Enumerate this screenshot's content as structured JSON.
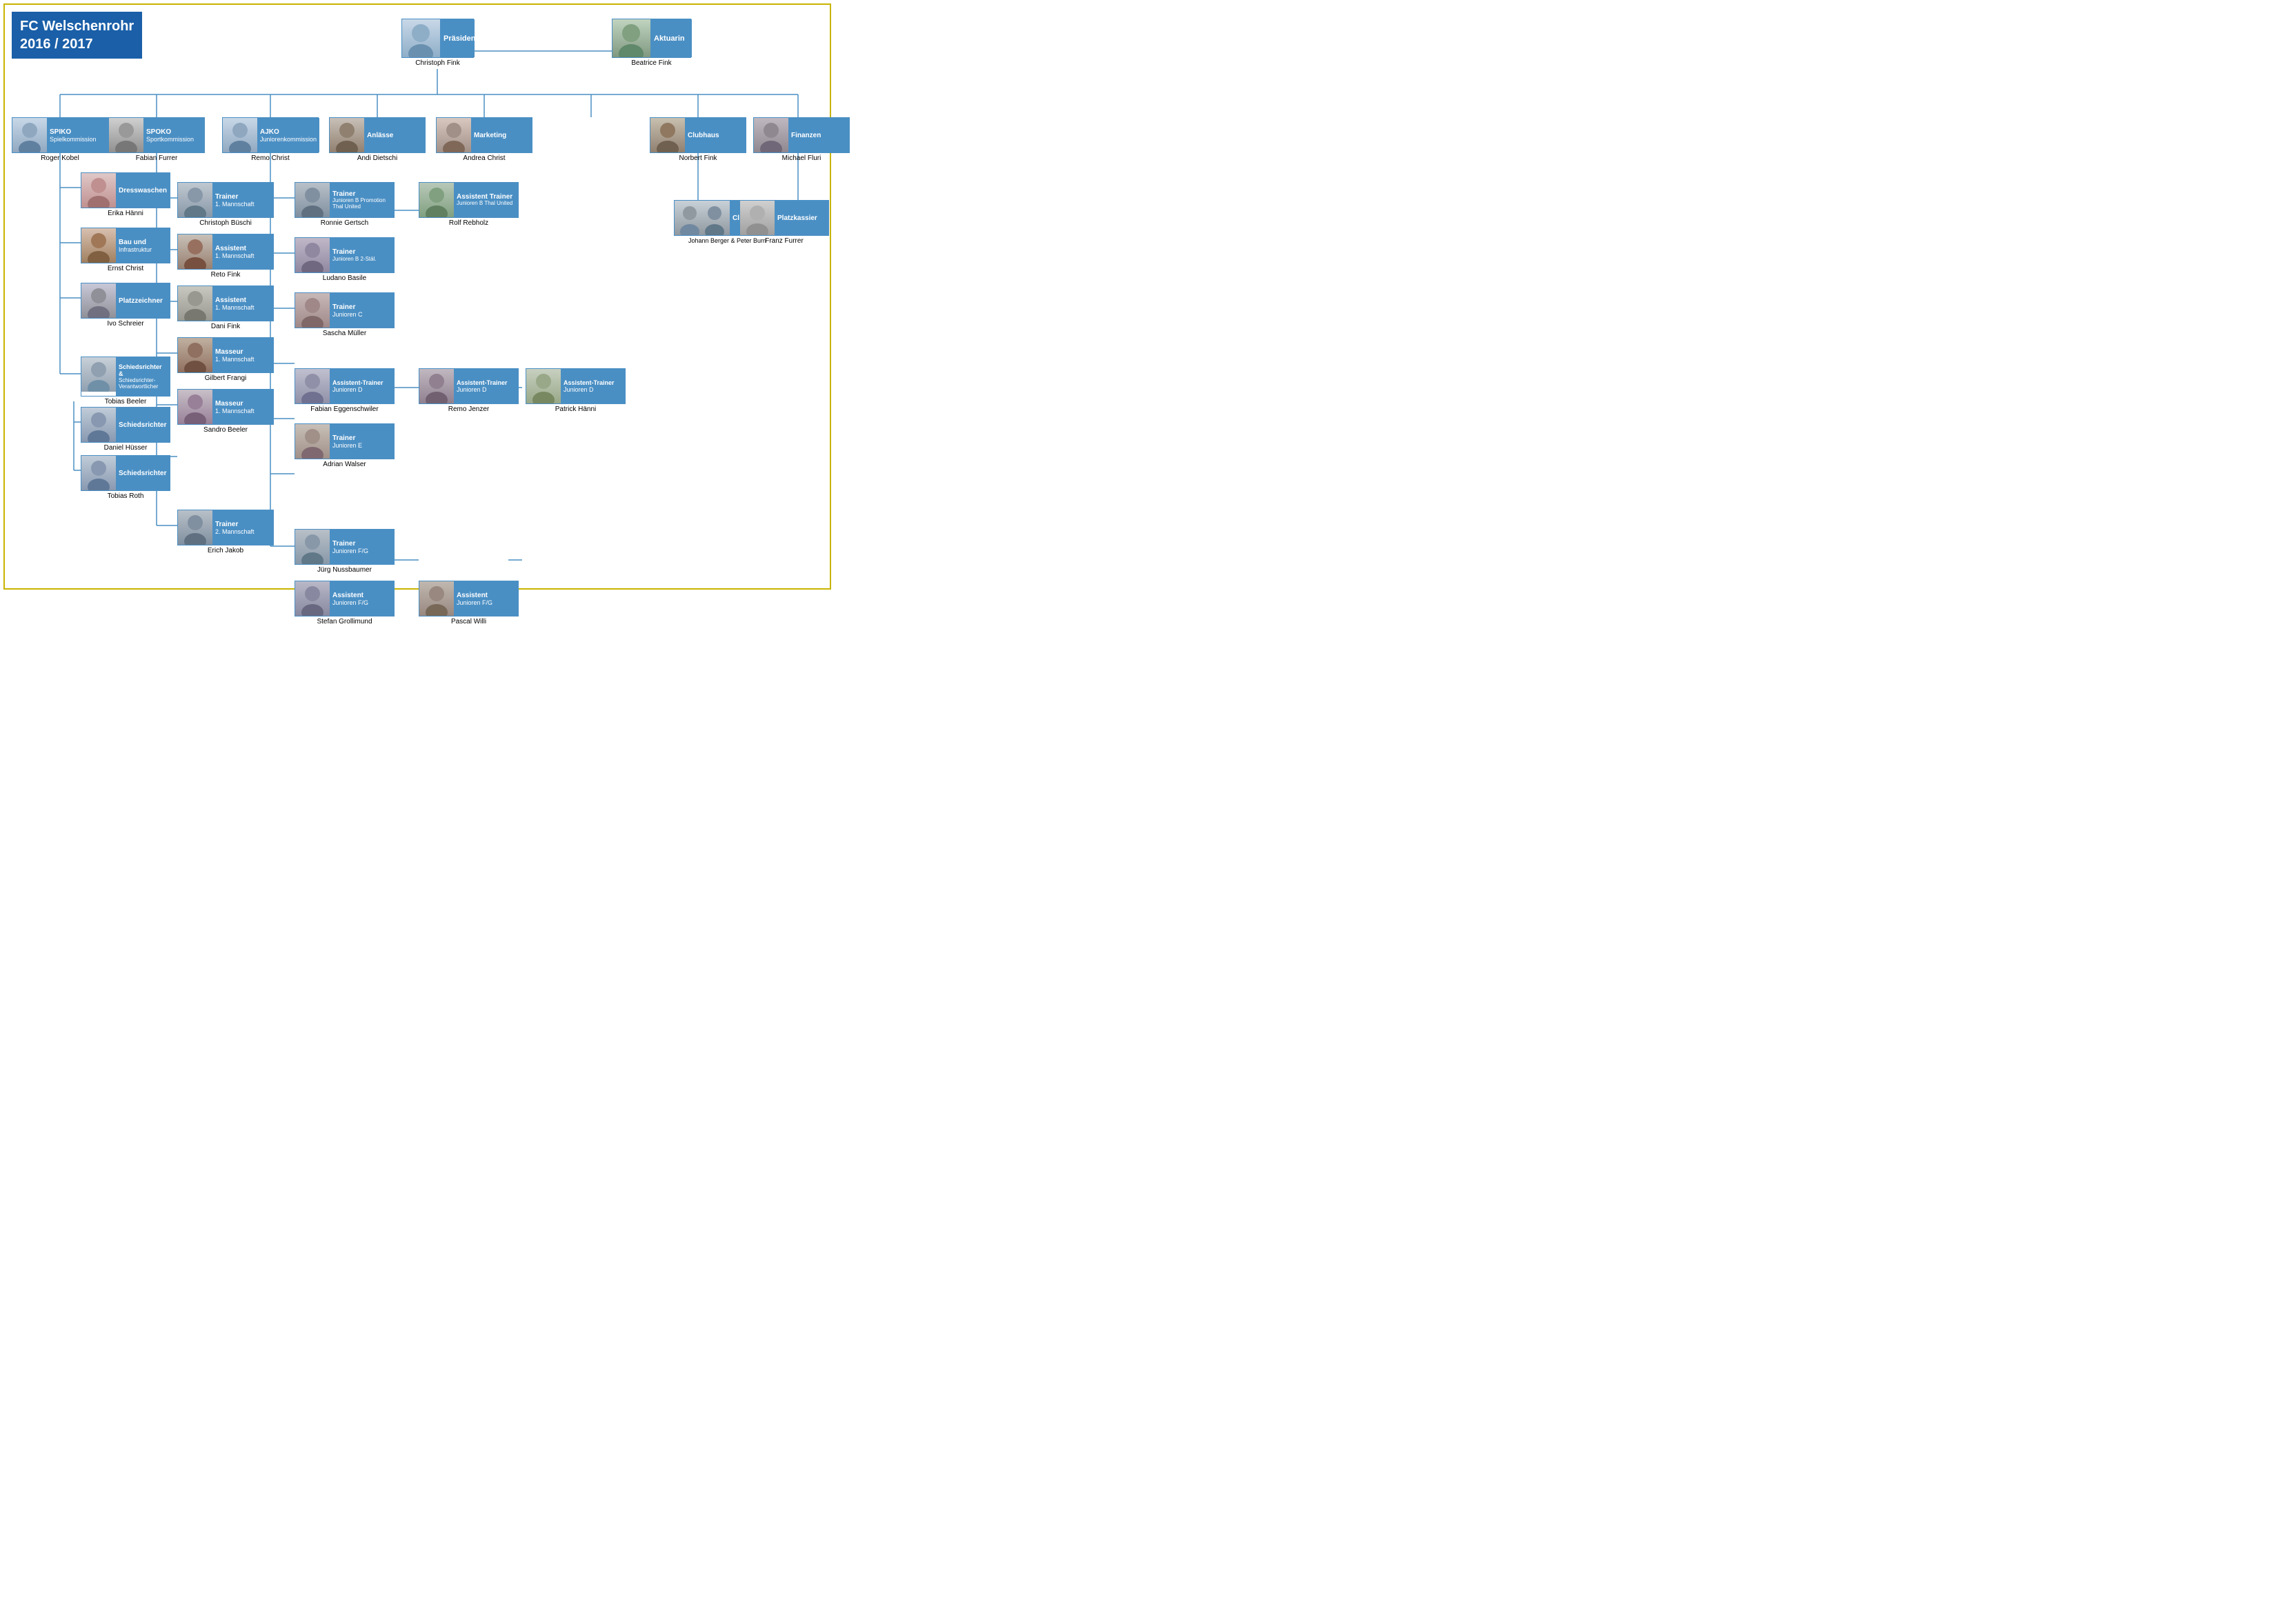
{
  "title": {
    "line1": "FC Welschenrohr",
    "line2": "2016 / 2017"
  },
  "colors": {
    "blue": "#1a5fa8",
    "card_blue": "#4a8fc4",
    "border": "#c8b400"
  },
  "nodes": {
    "president": {
      "role": "Präsident",
      "name": "Christoph Fink"
    },
    "aktuarin": {
      "role": "Aktuarin",
      "name": "Beatrice Fink"
    },
    "spiko": {
      "role": "SPIKO",
      "subrole": "Spielkommission",
      "name": "Roger Kobel"
    },
    "spoko": {
      "role": "SPOKO",
      "subrole": "Sportkommission",
      "name": "Fabian Furrer"
    },
    "ajko": {
      "role": "AJKO",
      "subrole": "Juniorenkommission",
      "name": "Remo Christ"
    },
    "anlaesse": {
      "role": "Anlässe",
      "name": "Andi Dietschi"
    },
    "marketing": {
      "role": "Marketing",
      "name": "Andrea Christ"
    },
    "clubhaus": {
      "role": "Clubhaus",
      "name": "Norbert Fink"
    },
    "finanzen": {
      "role": "Finanzen",
      "name": "Michael Fluri"
    },
    "dresswaschen": {
      "role": "Dresswaschen",
      "name": "Erika Hänni"
    },
    "bau": {
      "role": "Bau und",
      "subrole": "Infrastruktur",
      "name": "Ernst Christ"
    },
    "platzzeichner": {
      "role": "Platzzeichner",
      "name": "Ivo Schreier"
    },
    "schiri_verantwortlicher": {
      "role": "Schiedsrichter &",
      "subrole": "Schiedsrichter-Verantwortlicher",
      "name": "Tobias Beeler"
    },
    "schiri1": {
      "role": "Schiedsrichter",
      "name": "Daniel Hüsser"
    },
    "schiri2": {
      "role": "Schiedsrichter",
      "name": "Tobias Roth"
    },
    "trainer1": {
      "role": "Trainer",
      "subrole": "1. Mannschaft",
      "name": "Christoph Büschi"
    },
    "assistent1a": {
      "role": "Assistent",
      "subrole": "1. Mannschaft",
      "name": "Reto Fink"
    },
    "assistent1b": {
      "role": "Assistent",
      "subrole": "1. Mannschaft",
      "name": "Dani Fink"
    },
    "masseur1a": {
      "role": "Masseur",
      "subrole": "1. Mannschaft",
      "name": "Gilbert Frangi"
    },
    "masseur1b": {
      "role": "Masseur",
      "subrole": "1. Mannschaft",
      "name": "Sandro Beeler"
    },
    "trainer2": {
      "role": "Trainer",
      "subrole": "2. Mannschaft",
      "name": "Erich Jakob"
    },
    "trainer_jb_promo": {
      "role": "Trainer",
      "subrole": "Junioren B Promotion Thal United",
      "name": "Ronnie Gertsch"
    },
    "assist_trainer_jb": {
      "role": "Assistent Trainer",
      "subrole": "Junioren B Thal United",
      "name": "Rolf Rebholz"
    },
    "trainer_jb2": {
      "role": "Trainer",
      "subrole": "Junioren B 2-Stäl.",
      "name": "Ludano Basile"
    },
    "trainer_jc": {
      "role": "Trainer",
      "subrole": "Junioren C",
      "name": "Sascha Müller"
    },
    "assist_trainer_jd1": {
      "role": "Assistent-Trainer",
      "subrole": "Junioren D",
      "name": "Fabian Eggenschwiler"
    },
    "assist_trainer_jd2": {
      "role": "Assistent-Trainer",
      "subrole": "Junioren D",
      "name": "Remo Jenzer"
    },
    "assist_trainer_jd3": {
      "role": "Assistent-Trainer",
      "subrole": "Junioren D",
      "name": "Patrick Hänni"
    },
    "trainer_je": {
      "role": "Trainer",
      "subrole": "Junioren E",
      "name": "Adrian Walser"
    },
    "trainer_jfg": {
      "role": "Trainer",
      "subrole": "Junioren F/G",
      "name": "Jürg Nussbaumer"
    },
    "assist_jfg1": {
      "role": "Assistent",
      "subrole": "Junioren F/G",
      "name": "Stefan Grollimund"
    },
    "assist_jfg2": {
      "role": "Assistent",
      "subrole": "Junioren F/G",
      "name": "Pascal Willi"
    },
    "clubhauswirte": {
      "role": "Clubhauswirte",
      "name": "Johann Berger & Peter Burri"
    },
    "platzkassier": {
      "role": "Platzkassier",
      "name": "Franz Furrer"
    }
  }
}
